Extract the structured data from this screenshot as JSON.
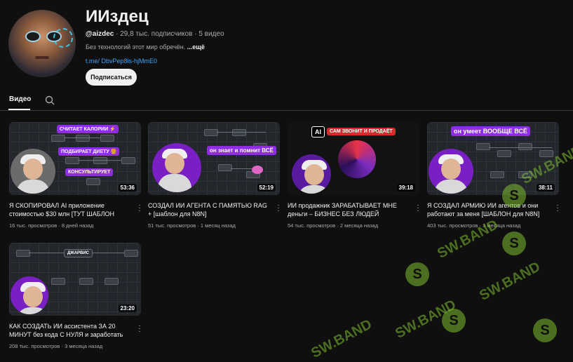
{
  "channel": {
    "name": "ИИздец",
    "handle": "@aizdec",
    "subscribers": "29,8 тыс. подписчиков",
    "video_count": "5 видео",
    "description": "Без технологий этот мир обречён.",
    "more_label": "...ещё",
    "link": "t.me/ DbvPep8is-hjMmE0",
    "subscribe_label": "Подписаться"
  },
  "tabs": {
    "videos_label": "Видео"
  },
  "videos": [
    {
      "title": "Я СКОПИРОВАЛ AI приложение стоимостью $30 млн [ТУТ ШАБЛОН для...",
      "views": "16 тыс. просмотров",
      "age": "8 дней назад",
      "duration": "53:36",
      "thumb_tags": [
        "СЧИТАЕТ КАЛОРИИ ⚡",
        "ПОДБИРАЕТ ДИЕТУ 🍔",
        "КОНСУЛЬТИРУЕТ"
      ]
    },
    {
      "title": "СОЗДАЛ ИИ АГЕНТА С ПАМЯТЬЮ RAG + [шаблон для N8N]",
      "views": "51 тыс. просмотров",
      "age": "1 месяц назад",
      "duration": "52:19",
      "thumb_tags": [
        "он знает и помнит ВСЁ"
      ]
    },
    {
      "title": "ИИ продажник ЗАРАБАТЫВАЕТ МНЕ деньги – БИЗНЕС БЕЗ ЛЮДЕЙ",
      "views": "54 тыс. просмотров",
      "age": "2 месяца назад",
      "duration": "39:18",
      "thumb_tags": [
        "AI",
        "САМ ЗВОНИТ И ПРОДАЁТ"
      ]
    },
    {
      "title": "Я СОЗДАЛ АРМИЮ ИИ агентов и они работают за меня [ШАБЛОН для N8N]",
      "views": "403 тыс. просмотров",
      "age": "3 месяца назад",
      "duration": "38:11",
      "thumb_tags": [
        "он умеет ВООБЩЕ ВСЁ"
      ]
    },
    {
      "title": "КАК СОЗДАТЬ ИИ ассистента ЗА 20 МИНУТ без кода С НУЛЯ и заработать н...",
      "views": "208 тыс. просмотров",
      "age": "3 месяца назад",
      "duration": "23:20",
      "thumb_tags": [
        "ДЖАРВИС"
      ]
    }
  ],
  "watermark": "SW.BAND",
  "colors": {
    "accent_link": "#3ea6ff",
    "tag_purple": "#8e2de2",
    "tag_red": "#d62b2b",
    "watermark": "#7ebe32"
  }
}
